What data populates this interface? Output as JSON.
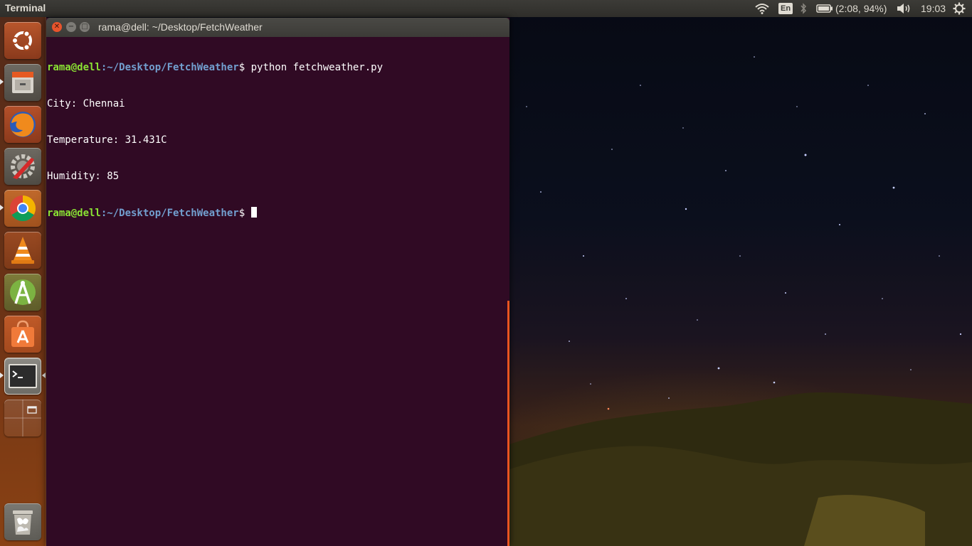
{
  "top_panel": {
    "app_name": "Terminal",
    "indicators": {
      "wifi_icon": "wifi-icon",
      "keyboard_layout": "En",
      "bluetooth_icon": "bluetooth-icon",
      "battery_text": "(2:08, 94%)",
      "volume_icon": "volume-icon",
      "clock": "19:03",
      "settings_icon": "gear-icon"
    }
  },
  "launcher": {
    "items": [
      {
        "name": "Ubuntu Dash",
        "icon": "ubuntu-logo-icon"
      },
      {
        "name": "Files",
        "icon": "file-cabinet-icon",
        "running": true
      },
      {
        "name": "Firefox",
        "icon": "firefox-icon"
      },
      {
        "name": "System Settings",
        "icon": "settings-wrench-icon"
      },
      {
        "name": "Chrome",
        "icon": "chrome-icon",
        "running": true
      },
      {
        "name": "VLC",
        "icon": "vlc-cone-icon"
      },
      {
        "name": "Android Studio",
        "icon": "android-studio-icon"
      },
      {
        "name": "Ubuntu Software",
        "icon": "software-bag-icon"
      },
      {
        "name": "Terminal",
        "icon": "terminal-icon",
        "running": true,
        "focused": true
      },
      {
        "name": "Workspace Switcher",
        "icon": "workspace-switcher-icon"
      },
      {
        "name": "Trash",
        "icon": "trash-icon"
      }
    ]
  },
  "terminal": {
    "window_title": "rama@dell: ~/Desktop/FetchWeather",
    "prompt_user": "rama@dell",
    "prompt_path": ":~/Desktop/FetchWeather",
    "prompt_symbol": "$ ",
    "command": "python fetchweather.py",
    "output": {
      "city": "City: Chennai",
      "temperature": "Temperature: 31.431C",
      "humidity": "Humidity: 85"
    }
  },
  "colors": {
    "terminal_bg": "#300a24",
    "prompt_user": "#8ae234",
    "prompt_path": "#729fcf",
    "ubuntu_orange": "#e95420",
    "panel_bg": "#3c3b37"
  }
}
